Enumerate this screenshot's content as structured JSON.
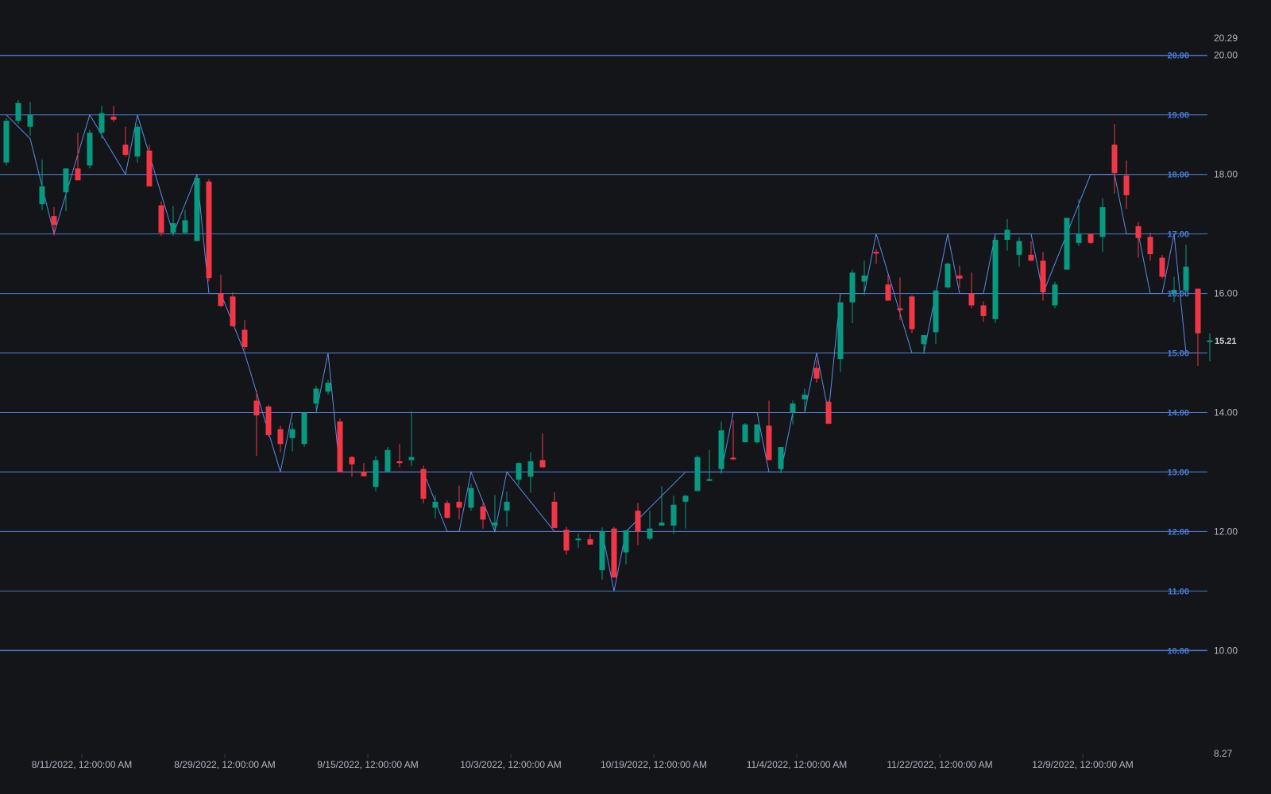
{
  "chart_data": {
    "type": "candlestick",
    "theme": {
      "background": "#131519",
      "up_color": "#089981",
      "down_color": "#f23645",
      "level_line_color": "#4a78c8",
      "zigzag_color": "#5b8be0",
      "axis_text_color": "#b2b5be",
      "last_value_color": "#d1d4dc"
    },
    "y_axis": {
      "position": "right",
      "range": [
        8.27,
        20.29
      ],
      "tick_labels": [
        "20.29",
        "20.00",
        "18.00",
        "16.00",
        "14.00",
        "12.00",
        "10.00",
        "8.27"
      ],
      "tick_values": [
        20.29,
        20.0,
        18.0,
        16.0,
        14.0,
        12.0,
        10.0,
        8.27
      ]
    },
    "x_axis": {
      "position": "bottom",
      "tick_labels": [
        "8/11/2022, 12:00:00 AM",
        "8/29/2022, 12:00:00 AM",
        "9/15/2022, 12:00:00 AM",
        "10/3/2022, 12:00:00 AM",
        "10/19/2022, 12:00:00 AM",
        "11/4/2022, 12:00:00 AM",
        "11/22/2022, 12:00:00 AM",
        "12/9/2022, 12:00:00 AM"
      ],
      "tick_bar_index": [
        6,
        18,
        30,
        42,
        54,
        66,
        78,
        90
      ]
    },
    "levels": {
      "values": [
        20,
        19,
        18,
        17,
        16,
        15,
        14,
        13,
        12,
        11,
        10
      ],
      "labels": [
        "20.00",
        "19.00",
        "18.00",
        "17.00",
        "16.00",
        "15.00",
        "14.00",
        "13.00",
        "12.00",
        "11.00",
        "10.00"
      ]
    },
    "last_value": {
      "value": 15.21,
      "label": "15.21"
    },
    "candles": [
      {
        "o": 18.2,
        "h": 18.95,
        "l": 18.15,
        "c": 18.9
      },
      {
        "o": 18.9,
        "h": 19.25,
        "l": 18.85,
        "c": 19.2
      },
      {
        "o": 18.8,
        "h": 19.22,
        "l": 18.65,
        "c": 19.0
      },
      {
        "o": 17.5,
        "h": 18.25,
        "l": 17.4,
        "c": 17.8
      },
      {
        "o": 17.3,
        "h": 17.45,
        "l": 16.97,
        "c": 17.15
      },
      {
        "o": 17.7,
        "h": 18.1,
        "l": 17.38,
        "c": 18.1
      },
      {
        "o": 18.1,
        "h": 18.7,
        "l": 17.95,
        "c": 17.9
      },
      {
        "o": 18.15,
        "h": 18.75,
        "l": 18.1,
        "c": 18.7
      },
      {
        "o": 18.7,
        "h": 19.15,
        "l": 18.6,
        "c": 19.03
      },
      {
        "o": 18.97,
        "h": 19.15,
        "l": 18.88,
        "c": 18.92
      },
      {
        "o": 18.5,
        "h": 18.8,
        "l": 18.3,
        "c": 18.33
      },
      {
        "o": 18.3,
        "h": 18.85,
        "l": 18.2,
        "c": 18.8
      },
      {
        "o": 18.4,
        "h": 18.5,
        "l": 17.8,
        "c": 17.8
      },
      {
        "o": 17.48,
        "h": 17.55,
        "l": 16.97,
        "c": 17.02
      },
      {
        "o": 17.02,
        "h": 17.47,
        "l": 16.97,
        "c": 17.18
      },
      {
        "o": 17.02,
        "h": 17.4,
        "l": 17.0,
        "c": 17.23
      },
      {
        "o": 16.88,
        "h": 17.97,
        "l": 16.88,
        "c": 17.94
      },
      {
        "o": 17.88,
        "h": 17.92,
        "l": 16.2,
        "c": 16.26
      },
      {
        "o": 16.0,
        "h": 16.32,
        "l": 15.77,
        "c": 15.79
      },
      {
        "o": 15.95,
        "h": 16.02,
        "l": 15.44,
        "c": 15.45
      },
      {
        "o": 15.39,
        "h": 15.55,
        "l": 15.05,
        "c": 15.1
      },
      {
        "o": 14.2,
        "h": 14.37,
        "l": 13.27,
        "c": 13.95
      },
      {
        "o": 14.1,
        "h": 14.13,
        "l": 13.6,
        "c": 13.62
      },
      {
        "o": 13.72,
        "h": 13.78,
        "l": 13.33,
        "c": 13.47
      },
      {
        "o": 13.57,
        "h": 13.83,
        "l": 13.35,
        "c": 13.72
      },
      {
        "o": 13.47,
        "h": 14.0,
        "l": 13.42,
        "c": 14.0
      },
      {
        "o": 14.15,
        "h": 14.45,
        "l": 14.05,
        "c": 14.4
      },
      {
        "o": 14.35,
        "h": 14.55,
        "l": 14.3,
        "c": 14.5
      },
      {
        "o": 13.85,
        "h": 13.9,
        "l": 12.99,
        "c": 13.0
      },
      {
        "o": 13.25,
        "h": 13.27,
        "l": 12.92,
        "c": 13.13
      },
      {
        "o": 13.0,
        "h": 13.15,
        "l": 12.92,
        "c": 12.93
      },
      {
        "o": 12.75,
        "h": 13.27,
        "l": 12.67,
        "c": 13.2
      },
      {
        "o": 13.01,
        "h": 13.42,
        "l": 13.0,
        "c": 13.37
      },
      {
        "o": 13.18,
        "h": 13.47,
        "l": 13.08,
        "c": 13.15
      },
      {
        "o": 13.2,
        "h": 14.02,
        "l": 13.1,
        "c": 13.25
      },
      {
        "o": 13.05,
        "h": 13.11,
        "l": 12.47,
        "c": 12.55
      },
      {
        "o": 12.4,
        "h": 12.61,
        "l": 12.22,
        "c": 12.5
      },
      {
        "o": 12.48,
        "h": 12.52,
        "l": 12.22,
        "c": 12.23
      },
      {
        "o": 12.5,
        "h": 12.77,
        "l": 12.2,
        "c": 12.4
      },
      {
        "o": 12.4,
        "h": 12.8,
        "l": 12.35,
        "c": 12.73
      },
      {
        "o": 12.42,
        "h": 12.48,
        "l": 12.05,
        "c": 12.2
      },
      {
        "o": 12.1,
        "h": 12.61,
        "l": 12.03,
        "c": 12.15
      },
      {
        "o": 12.35,
        "h": 12.67,
        "l": 12.08,
        "c": 12.5
      },
      {
        "o": 12.87,
        "h": 13.17,
        "l": 12.78,
        "c": 13.15
      },
      {
        "o": 12.92,
        "h": 13.33,
        "l": 12.65,
        "c": 13.18
      },
      {
        "o": 13.2,
        "h": 13.65,
        "l": 13.07,
        "c": 13.08
      },
      {
        "o": 12.5,
        "h": 12.66,
        "l": 12.05,
        "c": 12.06
      },
      {
        "o": 12.03,
        "h": 12.08,
        "l": 11.61,
        "c": 11.68
      },
      {
        "o": 11.87,
        "h": 11.97,
        "l": 11.72,
        "c": 11.88
      },
      {
        "o": 11.87,
        "h": 11.96,
        "l": 11.78,
        "c": 11.78
      },
      {
        "o": 11.35,
        "h": 12.07,
        "l": 11.19,
        "c": 12.0
      },
      {
        "o": 12.05,
        "h": 12.08,
        "l": 11.22,
        "c": 11.23
      },
      {
        "o": 11.65,
        "h": 12.02,
        "l": 11.45,
        "c": 12.02
      },
      {
        "o": 12.35,
        "h": 12.48,
        "l": 11.77,
        "c": 12.0
      },
      {
        "o": 11.88,
        "h": 12.35,
        "l": 11.85,
        "c": 12.05
      },
      {
        "o": 12.1,
        "h": 12.76,
        "l": 12.1,
        "c": 12.15
      },
      {
        "o": 12.1,
        "h": 12.6,
        "l": 11.96,
        "c": 12.45
      },
      {
        "o": 12.5,
        "h": 12.62,
        "l": 12.05,
        "c": 12.6
      },
      {
        "o": 12.68,
        "h": 13.28,
        "l": 12.68,
        "c": 13.25
      },
      {
        "o": 12.85,
        "h": 13.37,
        "l": 12.85,
        "c": 12.88
      },
      {
        "o": 13.05,
        "h": 13.85,
        "l": 12.97,
        "c": 13.7
      },
      {
        "o": 13.24,
        "h": 13.87,
        "l": 13.2,
        "c": 13.22
      },
      {
        "o": 13.5,
        "h": 13.82,
        "l": 13.5,
        "c": 13.8
      },
      {
        "o": 13.5,
        "h": 13.8,
        "l": 13.48,
        "c": 13.8
      },
      {
        "o": 13.78,
        "h": 14.2,
        "l": 13.27,
        "c": 13.2
      },
      {
        "o": 13.05,
        "h": 13.41,
        "l": 12.98,
        "c": 13.42
      },
      {
        "o": 14.0,
        "h": 14.2,
        "l": 13.8,
        "c": 14.15
      },
      {
        "o": 14.22,
        "h": 14.4,
        "l": 14.0,
        "c": 14.3
      },
      {
        "o": 14.75,
        "h": 14.88,
        "l": 14.5,
        "c": 14.57
      },
      {
        "o": 14.18,
        "h": 14.2,
        "l": 13.8,
        "c": 13.81
      },
      {
        "o": 14.9,
        "h": 15.85,
        "l": 14.68,
        "c": 15.85
      },
      {
        "o": 15.85,
        "h": 16.4,
        "l": 15.5,
        "c": 16.35
      },
      {
        "o": 16.2,
        "h": 16.55,
        "l": 15.97,
        "c": 16.3
      },
      {
        "o": 16.7,
        "h": 16.75,
        "l": 16.5,
        "c": 16.67
      },
      {
        "o": 16.15,
        "h": 16.32,
        "l": 15.88,
        "c": 15.88
      },
      {
        "o": 15.75,
        "h": 16.27,
        "l": 15.55,
        "c": 15.72
      },
      {
        "o": 15.95,
        "h": 15.97,
        "l": 15.33,
        "c": 15.4
      },
      {
        "o": 15.15,
        "h": 15.3,
        "l": 14.98,
        "c": 15.3
      },
      {
        "o": 15.35,
        "h": 16.0,
        "l": 15.15,
        "c": 16.05
      },
      {
        "o": 16.1,
        "h": 16.52,
        "l": 16.08,
        "c": 16.5
      },
      {
        "o": 16.3,
        "h": 16.47,
        "l": 16.1,
        "c": 16.25
      },
      {
        "o": 16.0,
        "h": 16.35,
        "l": 15.75,
        "c": 15.8
      },
      {
        "o": 15.8,
        "h": 15.87,
        "l": 15.52,
        "c": 15.62
      },
      {
        "o": 15.57,
        "h": 16.95,
        "l": 15.5,
        "c": 16.9
      },
      {
        "o": 16.9,
        "h": 17.25,
        "l": 16.72,
        "c": 17.07
      },
      {
        "o": 16.65,
        "h": 16.95,
        "l": 16.45,
        "c": 16.88
      },
      {
        "o": 16.65,
        "h": 16.88,
        "l": 16.55,
        "c": 16.55
      },
      {
        "o": 16.55,
        "h": 16.7,
        "l": 15.88,
        "c": 16.02
      },
      {
        "o": 15.8,
        "h": 16.2,
        "l": 15.75,
        "c": 16.15
      },
      {
        "o": 16.4,
        "h": 17.15,
        "l": 16.4,
        "c": 17.27
      },
      {
        "o": 16.85,
        "h": 17.58,
        "l": 16.8,
        "c": 17.0
      },
      {
        "o": 17.0,
        "h": 17.0,
        "l": 16.83,
        "c": 16.85
      },
      {
        "o": 16.95,
        "h": 17.6,
        "l": 16.7,
        "c": 17.45
      },
      {
        "o": 18.5,
        "h": 18.85,
        "l": 17.68,
        "c": 18.02
      },
      {
        "o": 17.98,
        "h": 18.23,
        "l": 17.42,
        "c": 17.65
      },
      {
        "o": 17.13,
        "h": 17.2,
        "l": 16.6,
        "c": 16.93
      },
      {
        "o": 16.95,
        "h": 17.02,
        "l": 16.55,
        "c": 16.66
      },
      {
        "o": 16.6,
        "h": 16.65,
        "l": 16.25,
        "c": 16.28
      },
      {
        "o": 16.0,
        "h": 16.28,
        "l": 15.85,
        "c": 16.06
      },
      {
        "o": 16.05,
        "h": 16.82,
        "l": 16.05,
        "c": 16.45
      },
      {
        "o": 16.08,
        "h": 16.08,
        "l": 14.78,
        "c": 15.33
      },
      {
        "o": 15.2,
        "h": 15.33,
        "l": 14.86,
        "c": 15.21
      }
    ],
    "zigzag": [
      {
        "i": 0,
        "v": 19.0
      },
      {
        "i": 2,
        "v": 18.6
      },
      {
        "i": 4,
        "v": 17.0
      },
      {
        "i": 7,
        "v": 19.0
      },
      {
        "i": 10,
        "v": 18.0
      },
      {
        "i": 11,
        "v": 19.0
      },
      {
        "i": 14,
        "v": 17.0
      },
      {
        "i": 16,
        "v": 18.0
      },
      {
        "i": 17,
        "v": 16.0
      },
      {
        "i": 18,
        "v": 16.0
      },
      {
        "i": 20,
        "v": 15.0
      },
      {
        "i": 23,
        "v": 13.0
      },
      {
        "i": 24,
        "v": 14.0
      },
      {
        "i": 26,
        "v": 14.0
      },
      {
        "i": 27,
        "v": 15.0
      },
      {
        "i": 28,
        "v": 13.0
      },
      {
        "i": 35,
        "v": 13.0
      },
      {
        "i": 37,
        "v": 12.0
      },
      {
        "i": 38,
        "v": 12.0
      },
      {
        "i": 39,
        "v": 13.0
      },
      {
        "i": 41,
        "v": 12.0
      },
      {
        "i": 42,
        "v": 13.0
      },
      {
        "i": 46,
        "v": 12.0
      },
      {
        "i": 50,
        "v": 12.0
      },
      {
        "i": 51,
        "v": 11.0
      },
      {
        "i": 52,
        "v": 12.0
      },
      {
        "i": 57,
        "v": 13.0
      },
      {
        "i": 60,
        "v": 13.0
      },
      {
        "i": 61,
        "v": 14.0
      },
      {
        "i": 63,
        "v": 14.0
      },
      {
        "i": 64,
        "v": 13.0
      },
      {
        "i": 65,
        "v": 13.0
      },
      {
        "i": 66,
        "v": 14.0
      },
      {
        "i": 67,
        "v": 14.0
      },
      {
        "i": 68,
        "v": 15.0
      },
      {
        "i": 69,
        "v": 14.0
      },
      {
        "i": 70,
        "v": 16.0
      },
      {
        "i": 72,
        "v": 16.0
      },
      {
        "i": 73,
        "v": 17.0
      },
      {
        "i": 76,
        "v": 15.0
      },
      {
        "i": 77,
        "v": 15.0
      },
      {
        "i": 78,
        "v": 16.0
      },
      {
        "i": 79,
        "v": 17.0
      },
      {
        "i": 80,
        "v": 16.0
      },
      {
        "i": 82,
        "v": 16.0
      },
      {
        "i": 83,
        "v": 17.0
      },
      {
        "i": 86,
        "v": 17.0
      },
      {
        "i": 87,
        "v": 16.0
      },
      {
        "i": 89,
        "v": 17.0
      },
      {
        "i": 91,
        "v": 18.0
      },
      {
        "i": 93,
        "v": 18.0
      },
      {
        "i": 94,
        "v": 17.0
      },
      {
        "i": 95,
        "v": 17.0
      },
      {
        "i": 96,
        "v": 16.0
      },
      {
        "i": 97,
        "v": 16.0
      },
      {
        "i": 98,
        "v": 17.0
      },
      {
        "i": 99,
        "v": 15.0
      },
      {
        "i": 100,
        "v": 15.0
      }
    ]
  }
}
